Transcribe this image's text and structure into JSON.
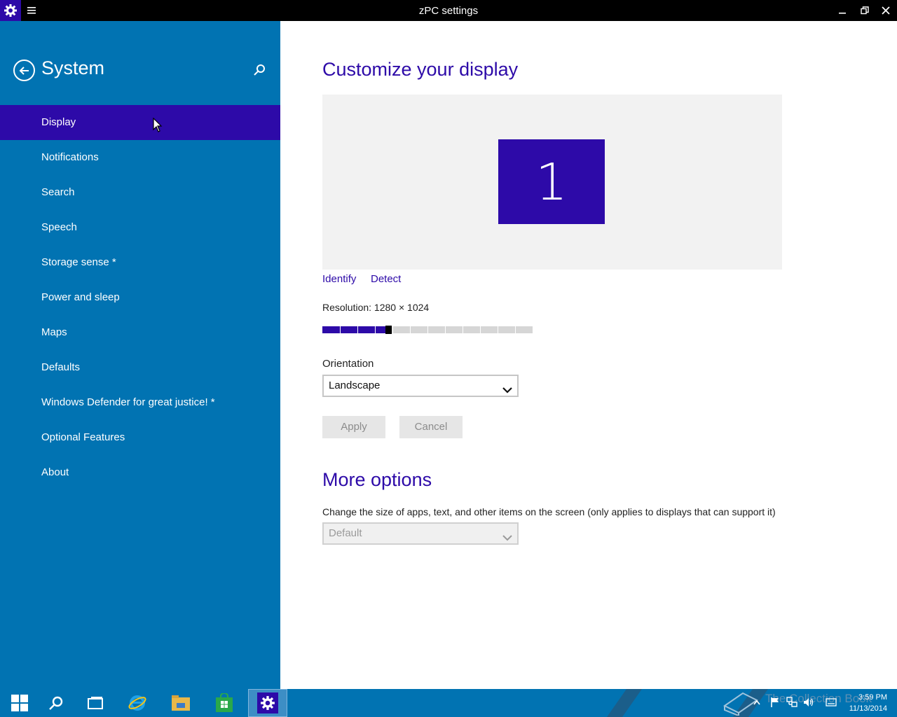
{
  "window": {
    "title": "zPC settings"
  },
  "sidebar": {
    "title": "System",
    "items": [
      {
        "label": "Display"
      },
      {
        "label": "Notifications"
      },
      {
        "label": "Search"
      },
      {
        "label": "Speech"
      },
      {
        "label": "Storage sense *"
      },
      {
        "label": "Power and sleep"
      },
      {
        "label": "Maps"
      },
      {
        "label": "Defaults"
      },
      {
        "label": "Windows Defender for great justice! *"
      },
      {
        "label": "Optional Features"
      },
      {
        "label": "About"
      }
    ],
    "active_index": 0
  },
  "main": {
    "heading": "Customize your display",
    "monitor_number": "1",
    "identify_label": "Identify",
    "detect_label": "Detect",
    "resolution_label": "Resolution: 1280 × 1024",
    "resolution_slider": {
      "value_fraction": 0.33
    },
    "orientation_label": "Orientation",
    "orientation_value": "Landscape",
    "apply_label": "Apply",
    "cancel_label": "Cancel",
    "more_options_heading": "More options",
    "size_description": "Change the size of apps, text, and other items on the screen (only applies to displays that can support it)",
    "size_value": "Default"
  },
  "taskbar": {
    "watermark": "The Collection Book",
    "time": "3:59 PM",
    "date": "11/13/2014"
  },
  "colors": {
    "accent": "#2d0aa8",
    "sidebar": "#0173b2",
    "taskbar": "#0173b2"
  }
}
